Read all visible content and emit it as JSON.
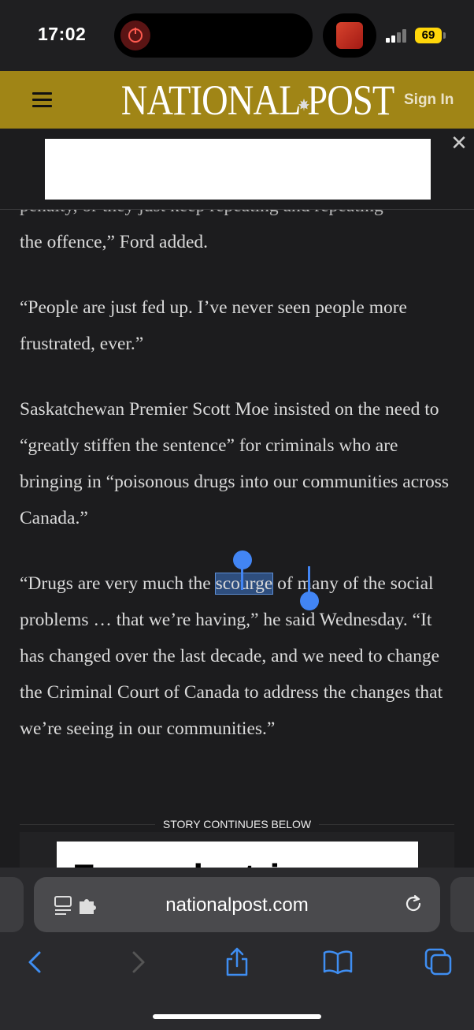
{
  "status_bar": {
    "time": "17:02",
    "battery": "69",
    "icons": [
      "screen-recording-icon",
      "now-playing-artwork-icon",
      "signal-icon",
      "battery-icon"
    ]
  },
  "masthead": {
    "brand_left": "NATIONAL",
    "brand_right": "POST",
    "sign_in": "Sign In",
    "accent_color": "#a08516"
  },
  "article": {
    "clipped_line": "penalty, or they just keep repeating and repeating",
    "p1_rest": "the offence,” Ford added.",
    "p2": "“People are just fed up. I’ve never seen people more frustrated, ever.”",
    "p3": "Saskatchewan Premier Scott Moe insisted on the need to “greatly stiffen the sentence” for criminals who are bringing in “poisonous drugs into our communities across Canada.”",
    "p4_before": "“Drugs are very much the ",
    "p4_selected": "scourge",
    "p4_after": " of many of the social problems … that we’re having,” he said Wednesday. “It has changed over the last decade, and we need to change the Criminal Court of Canada to address the changes that we’re seeing in our communities.”",
    "story_continues": "STORY CONTINUES BELOW",
    "ad_text": "From electric power"
  },
  "browser": {
    "url": "nationalpost.com",
    "selection_color": "#4285f4"
  }
}
